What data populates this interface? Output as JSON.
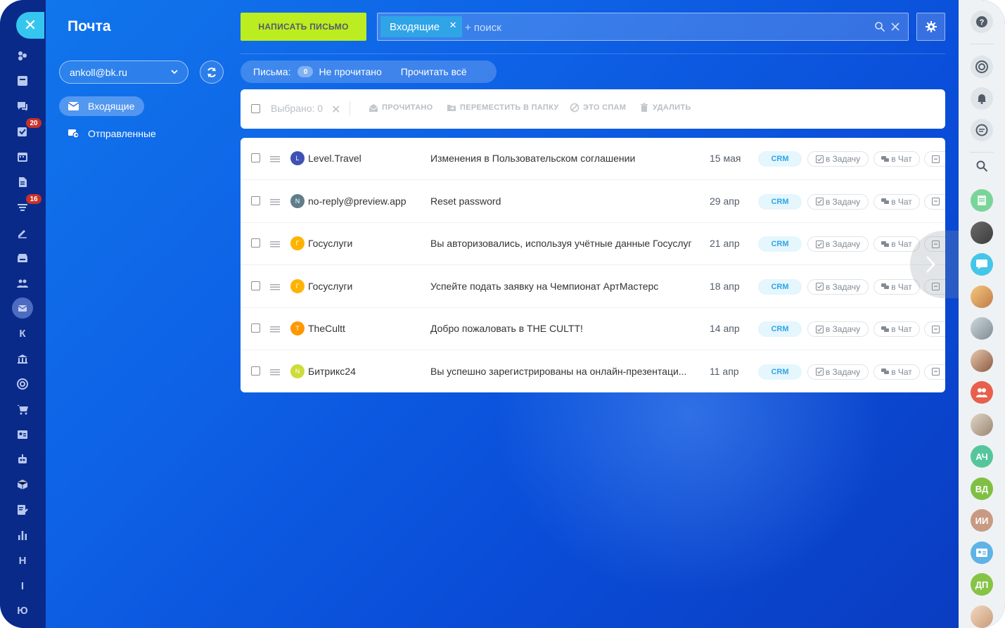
{
  "app": {
    "title": "Почта"
  },
  "leftnav": {
    "close_label": "✕",
    "badges": {
      "tasks": "20",
      "feed": "16"
    },
    "letters": [
      "К",
      "Н",
      "I",
      "Ю"
    ]
  },
  "sidebar": {
    "account": "ankoll@bk.ru",
    "folders": [
      {
        "label": "Входящие",
        "icon": "envelope-icon",
        "active": true
      },
      {
        "label": "Отправленные",
        "icon": "sent-icon",
        "active": false
      }
    ]
  },
  "toolbar": {
    "compose_label": "НАПИСАТЬ ПИСЬМО",
    "filter_chip": "Входящие",
    "search_placeholder": "+ поиск"
  },
  "counters": {
    "label": "Письма:",
    "unread_count": "0",
    "unread_label": "Не прочитано",
    "read_all": "Прочитать всё"
  },
  "actions": {
    "selected": "Выбрано: 0",
    "mark_read": "ПРОЧИТАНО",
    "move": "ПЕРЕМЕСТИТЬ В ПАПКУ",
    "spam": "ЭТО СПАМ",
    "delete": "УДАЛИТЬ"
  },
  "row_labels": {
    "crm": "CRM",
    "task": "в Задачу",
    "chat": "в Чат"
  },
  "messages": [
    {
      "initial": "L",
      "from": "Level.Travel",
      "subject": "Изменения в Пользовательском соглашении",
      "date": "15 мая",
      "color": "#3f51b5"
    },
    {
      "initial": "N",
      "from": "no-reply@preview.app",
      "subject": "Reset password",
      "date": "29 апр",
      "color": "#607d8b"
    },
    {
      "initial": "Г",
      "from": "Госуслуги",
      "subject": "Вы авторизовались, используя учётные данные Госуслуг",
      "date": "21 апр",
      "color": "#ffb300"
    },
    {
      "initial": "Г",
      "from": "Госуслуги",
      "subject": "Успейте подать заявку на Чемпионат АртМастерс",
      "date": "18 апр",
      "color": "#ffb300"
    },
    {
      "initial": "T",
      "from": "TheCultt",
      "subject": "Добро пожаловать в THE CULTT!",
      "date": "14 апр",
      "color": "#ff9800"
    },
    {
      "initial": "N",
      "from": "Битрикс24",
      "subject": "Вы успешно зарегистрированы на онлайн-презентаци...",
      "date": "11 апр",
      "color": "#cddc39"
    }
  ],
  "rightbar": {
    "initials": [
      "АЧ",
      "ВД",
      "ИИ",
      "ДП"
    ],
    "colors": {
      "ach": "#55c69b",
      "vd": "#7fc044",
      "ii": "#c89a84",
      "dp": "#86c347"
    }
  }
}
